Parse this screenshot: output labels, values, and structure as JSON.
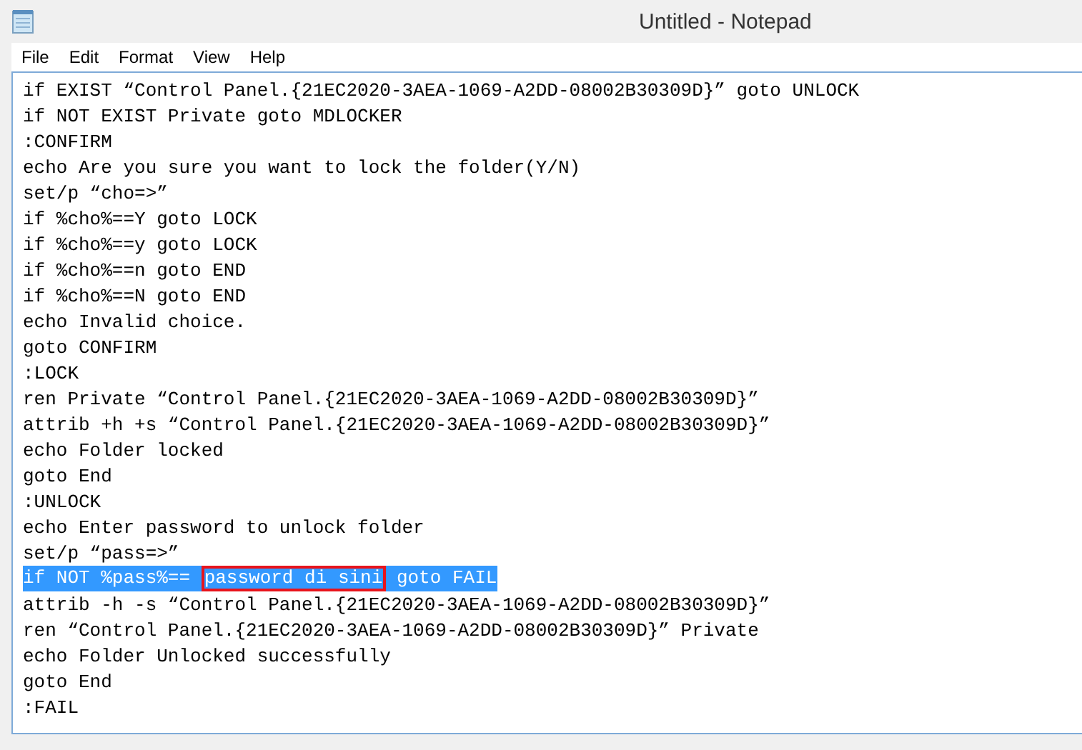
{
  "window": {
    "title": "Untitled - Notepad"
  },
  "menu": [
    "File",
    "Edit",
    "Format",
    "View",
    "Help"
  ],
  "lines": [
    {
      "text": "if EXIST “Control Panel.{21EC2020-3AEA-1069-A2DD-08002B30309D}” goto UNLOCK",
      "selected": false
    },
    {
      "text": "if NOT EXIST Private goto MDLOCKER",
      "selected": false
    },
    {
      "text": ":CONFIRM",
      "selected": false
    },
    {
      "text": "echo Are you sure you want to lock the folder(Y/N)",
      "selected": false
    },
    {
      "text": "set/p “cho=>”",
      "selected": false
    },
    {
      "text": "if %cho%==Y goto LOCK",
      "selected": false
    },
    {
      "text": "if %cho%==y goto LOCK",
      "selected": false
    },
    {
      "text": "if %cho%==n goto END",
      "selected": false
    },
    {
      "text": "if %cho%==N goto END",
      "selected": false
    },
    {
      "text": "echo Invalid choice.",
      "selected": false
    },
    {
      "text": "goto CONFIRM",
      "selected": false
    },
    {
      "text": ":LOCK",
      "selected": false
    },
    {
      "text": "ren Private “Control Panel.{21EC2020-3AEA-1069-A2DD-08002B30309D}”",
      "selected": false
    },
    {
      "text": "attrib +h +s “Control Panel.{21EC2020-3AEA-1069-A2DD-08002B30309D}”",
      "selected": false
    },
    {
      "text": "echo Folder locked",
      "selected": false
    },
    {
      "text": "goto End",
      "selected": false
    },
    {
      "text": ":UNLOCK",
      "selected": false
    },
    {
      "text": "echo Enter password to unlock folder",
      "selected": false
    },
    {
      "text": "set/p “pass=>”",
      "selected": false
    },
    {
      "segments": [
        {
          "text": "if NOT %pass%== ",
          "boxed": false
        },
        {
          "text": "password di sini",
          "boxed": true
        },
        {
          "text": " goto FAIL",
          "boxed": false
        }
      ],
      "selected": true
    },
    {
      "text": "attrib -h -s “Control Panel.{21EC2020-3AEA-1069-A2DD-08002B30309D}”",
      "selected": false
    },
    {
      "text": "ren “Control Panel.{21EC2020-3AEA-1069-A2DD-08002B30309D}” Private",
      "selected": false
    },
    {
      "text": "echo Folder Unlocked successfully",
      "selected": false
    },
    {
      "text": "goto End",
      "selected": false
    },
    {
      "text": ":FAIL",
      "selected": false
    }
  ]
}
